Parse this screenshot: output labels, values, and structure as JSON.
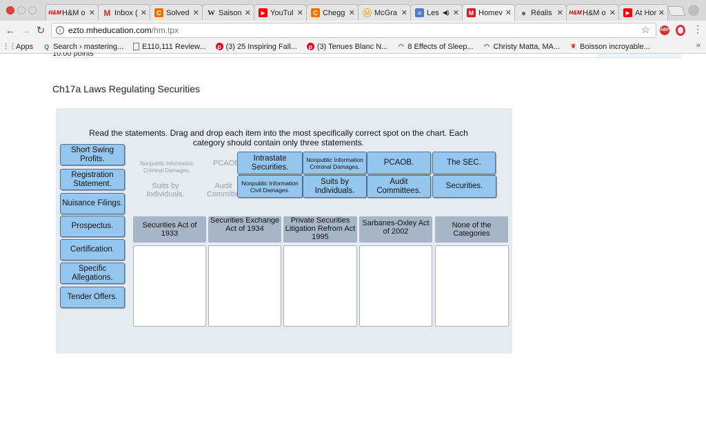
{
  "browser": {
    "tabs": [
      {
        "title": "H&M o",
        "icon": "hm-icon",
        "icon_text": "H&M",
        "icon_color": "#cc0000"
      },
      {
        "title": "Inbox (",
        "icon": "gmail-icon",
        "icon_text": "M",
        "icon_color": "#d93025"
      },
      {
        "title": "Solved",
        "icon": "chegg-icon",
        "icon_text": "C",
        "icon_color": "#eb7100"
      },
      {
        "title": "Saison",
        "icon": "wikipedia-icon",
        "icon_text": "W",
        "icon_color": "#555555"
      },
      {
        "title": "YouTul",
        "icon": "youtube-icon",
        "icon_text": "▶",
        "icon_color": "#ff0000"
      },
      {
        "title": "Chegg",
        "icon": "chegg-icon",
        "icon_text": "C",
        "icon_color": "#eb7100"
      },
      {
        "title": "McGra",
        "icon": "mcgraw-icon",
        "icon_text": "M",
        "icon_color": "#f5a623"
      },
      {
        "title": "Les",
        "icon": "document-icon",
        "icon_text": "≡",
        "icon_color": "#4a7bd0"
      },
      {
        "title": "Homev",
        "icon": "mheducation-icon",
        "icon_text": "M",
        "icon_color": "#d81b27"
      },
      {
        "title": "Réalis",
        "icon": "apple-icon",
        "icon_text": "",
        "icon_color": "#666666"
      },
      {
        "title": "H&M o",
        "icon": "hm-icon",
        "icon_text": "H&M",
        "icon_color": "#cc0000"
      },
      {
        "title": "At Hor",
        "icon": "youtube-icon",
        "icon_text": "▶",
        "icon_color": "#ff0000"
      }
    ],
    "active_tab": 8,
    "url_host": "ezto.mheducation.com",
    "url_path": "/hm.tpx",
    "bookmarks": [
      {
        "label": "Apps",
        "icon": "apps-icon"
      },
      {
        "label": "Search › mastering...",
        "icon": "search-icon"
      },
      {
        "label": "E110,111 Review...",
        "icon": "document-icon"
      },
      {
        "label": "(3) 25 Inspiring Fall...",
        "icon": "pinterest-icon"
      },
      {
        "label": "(3) Tenues Blanc N...",
        "icon": "pinterest-icon"
      },
      {
        "label": "8 Effects of Sleep...",
        "icon": "globe-icon"
      },
      {
        "label": "Christy Matta, MA...",
        "icon": "globe-icon"
      },
      {
        "label": "Boisson incroyable...",
        "icon": "leaf-icon"
      }
    ],
    "bookmarks_overflow": "»"
  },
  "page": {
    "points_cut": "10.00 points",
    "title": "Ch17a Laws Regulating Securities",
    "instructions": "Read the statements. Drag and drop each item into the most specifically correct spot on the chart. Each category should contain only three statements."
  },
  "items": {
    "short_swing": "Short Swing Profits.",
    "registration": "Registration Statement.",
    "nuisance": "Nuisance Filings.",
    "prospectus": "Prospectus.",
    "certification": "Certification.",
    "specific_allegations": "Specific Allegations.",
    "tender_offers": "Tender Offers.",
    "intrastate": "Intrastate Securities.",
    "nonpublic_criminal": "Nonpublic Information Criminal Damages.",
    "pcaob": "PCAOB.",
    "the_sec": "The SEC.",
    "nonpublic_civil": "Nonpublic Information Civil Damages.",
    "suits_by": "Suits by Individuals.",
    "audit_committees": "Audit Committees.",
    "securities": "Securities."
  },
  "ghosts": {
    "nonpublic_criminal": "Nonpublic Information Criminal Damages.",
    "suits_by": "Suits by Individuals.",
    "pcaob": "PCAOB.",
    "audit": "Audit Committees."
  },
  "categories": [
    "Securities Act of 1933",
    "Securities Exchange Act of 1934",
    "Private Securities Litigation Refrom Act 1995",
    "Sarbanes-Oxley Act of 2002",
    "None of the Categories"
  ]
}
